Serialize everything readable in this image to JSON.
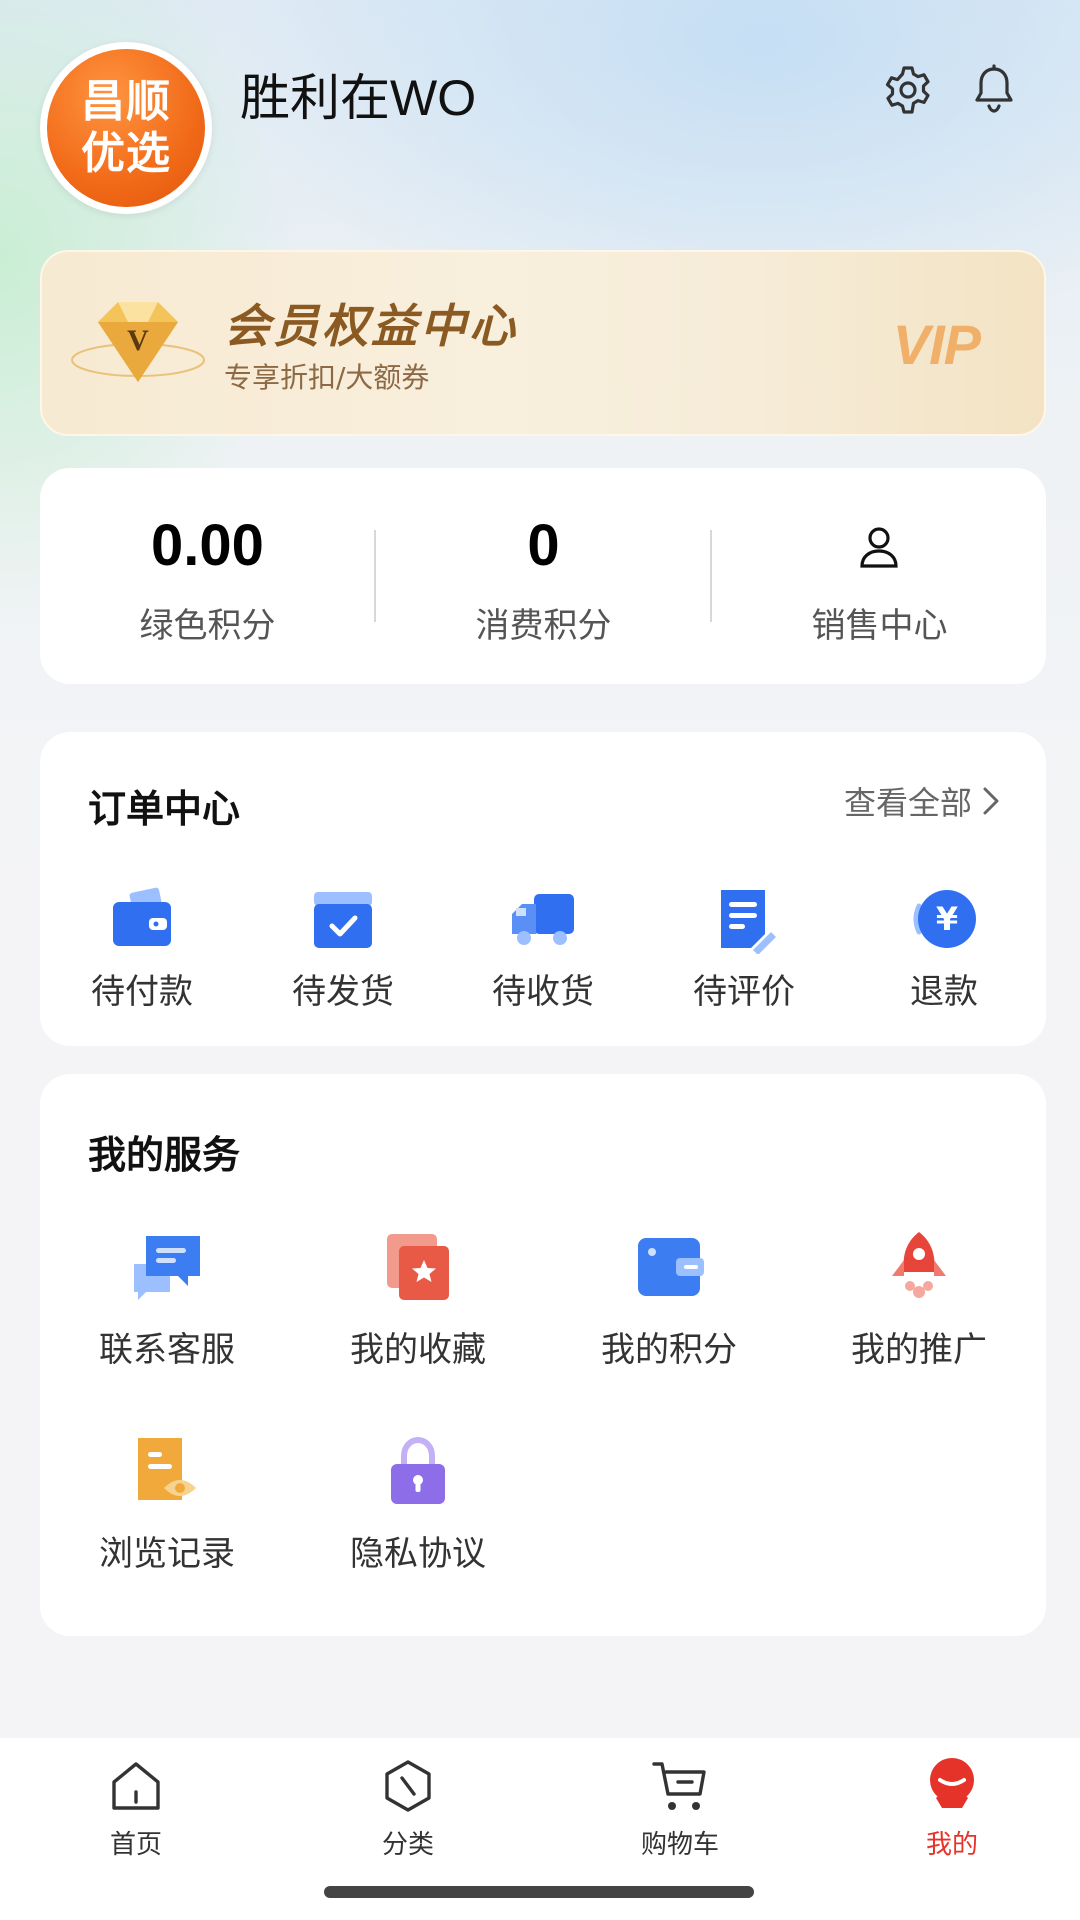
{
  "header": {
    "avatar_text_line1": "昌顺",
    "avatar_text_line2": "优选",
    "username": "胜利在WO",
    "settings_icon": "gear-icon",
    "notification_icon": "bell-icon"
  },
  "vip_banner": {
    "title": "会员权益中心",
    "subtitle": "专享折扣/大额券",
    "tag": "VIP",
    "icon": "diamond-v-icon"
  },
  "points": {
    "green_points_value": "0.00",
    "green_points_label": "绿色积分",
    "consume_points_value": "0",
    "consume_points_label": "消费积分",
    "sales_center_label": "销售中心",
    "sales_center_icon": "user-icon"
  },
  "orders": {
    "title": "订单中心",
    "view_all": "查看全部",
    "items": [
      {
        "label": "待付款",
        "icon": "wallet-icon"
      },
      {
        "label": "待发货",
        "icon": "box-check-icon"
      },
      {
        "label": "待收货",
        "icon": "truck-icon"
      },
      {
        "label": "待评价",
        "icon": "document-edit-icon"
      },
      {
        "label": "退款",
        "icon": "yuan-coin-icon"
      }
    ]
  },
  "services": {
    "title": "我的服务",
    "items": [
      {
        "label": "联系客服",
        "icon": "chat-bubbles-icon"
      },
      {
        "label": "我的收藏",
        "icon": "star-card-icon"
      },
      {
        "label": "我的积分",
        "icon": "wallet-card-icon"
      },
      {
        "label": "我的推广",
        "icon": "rocket-icon"
      },
      {
        "label": "浏览记录",
        "icon": "document-eye-icon"
      },
      {
        "label": "隐私协议",
        "icon": "lock-icon"
      }
    ]
  },
  "tabbar": {
    "items": [
      {
        "label": "首页",
        "icon": "home-icon"
      },
      {
        "label": "分类",
        "icon": "category-icon"
      },
      {
        "label": "购物车",
        "icon": "cart-icon"
      },
      {
        "label": "我的",
        "icon": "profile-mascot-icon"
      }
    ],
    "active_index": 3,
    "active_color": "#e6332a"
  },
  "colors": {
    "accent_blue": "#2f6ff0",
    "brand_orange": "#f16a18",
    "vip_gold": "#8a5a22"
  }
}
